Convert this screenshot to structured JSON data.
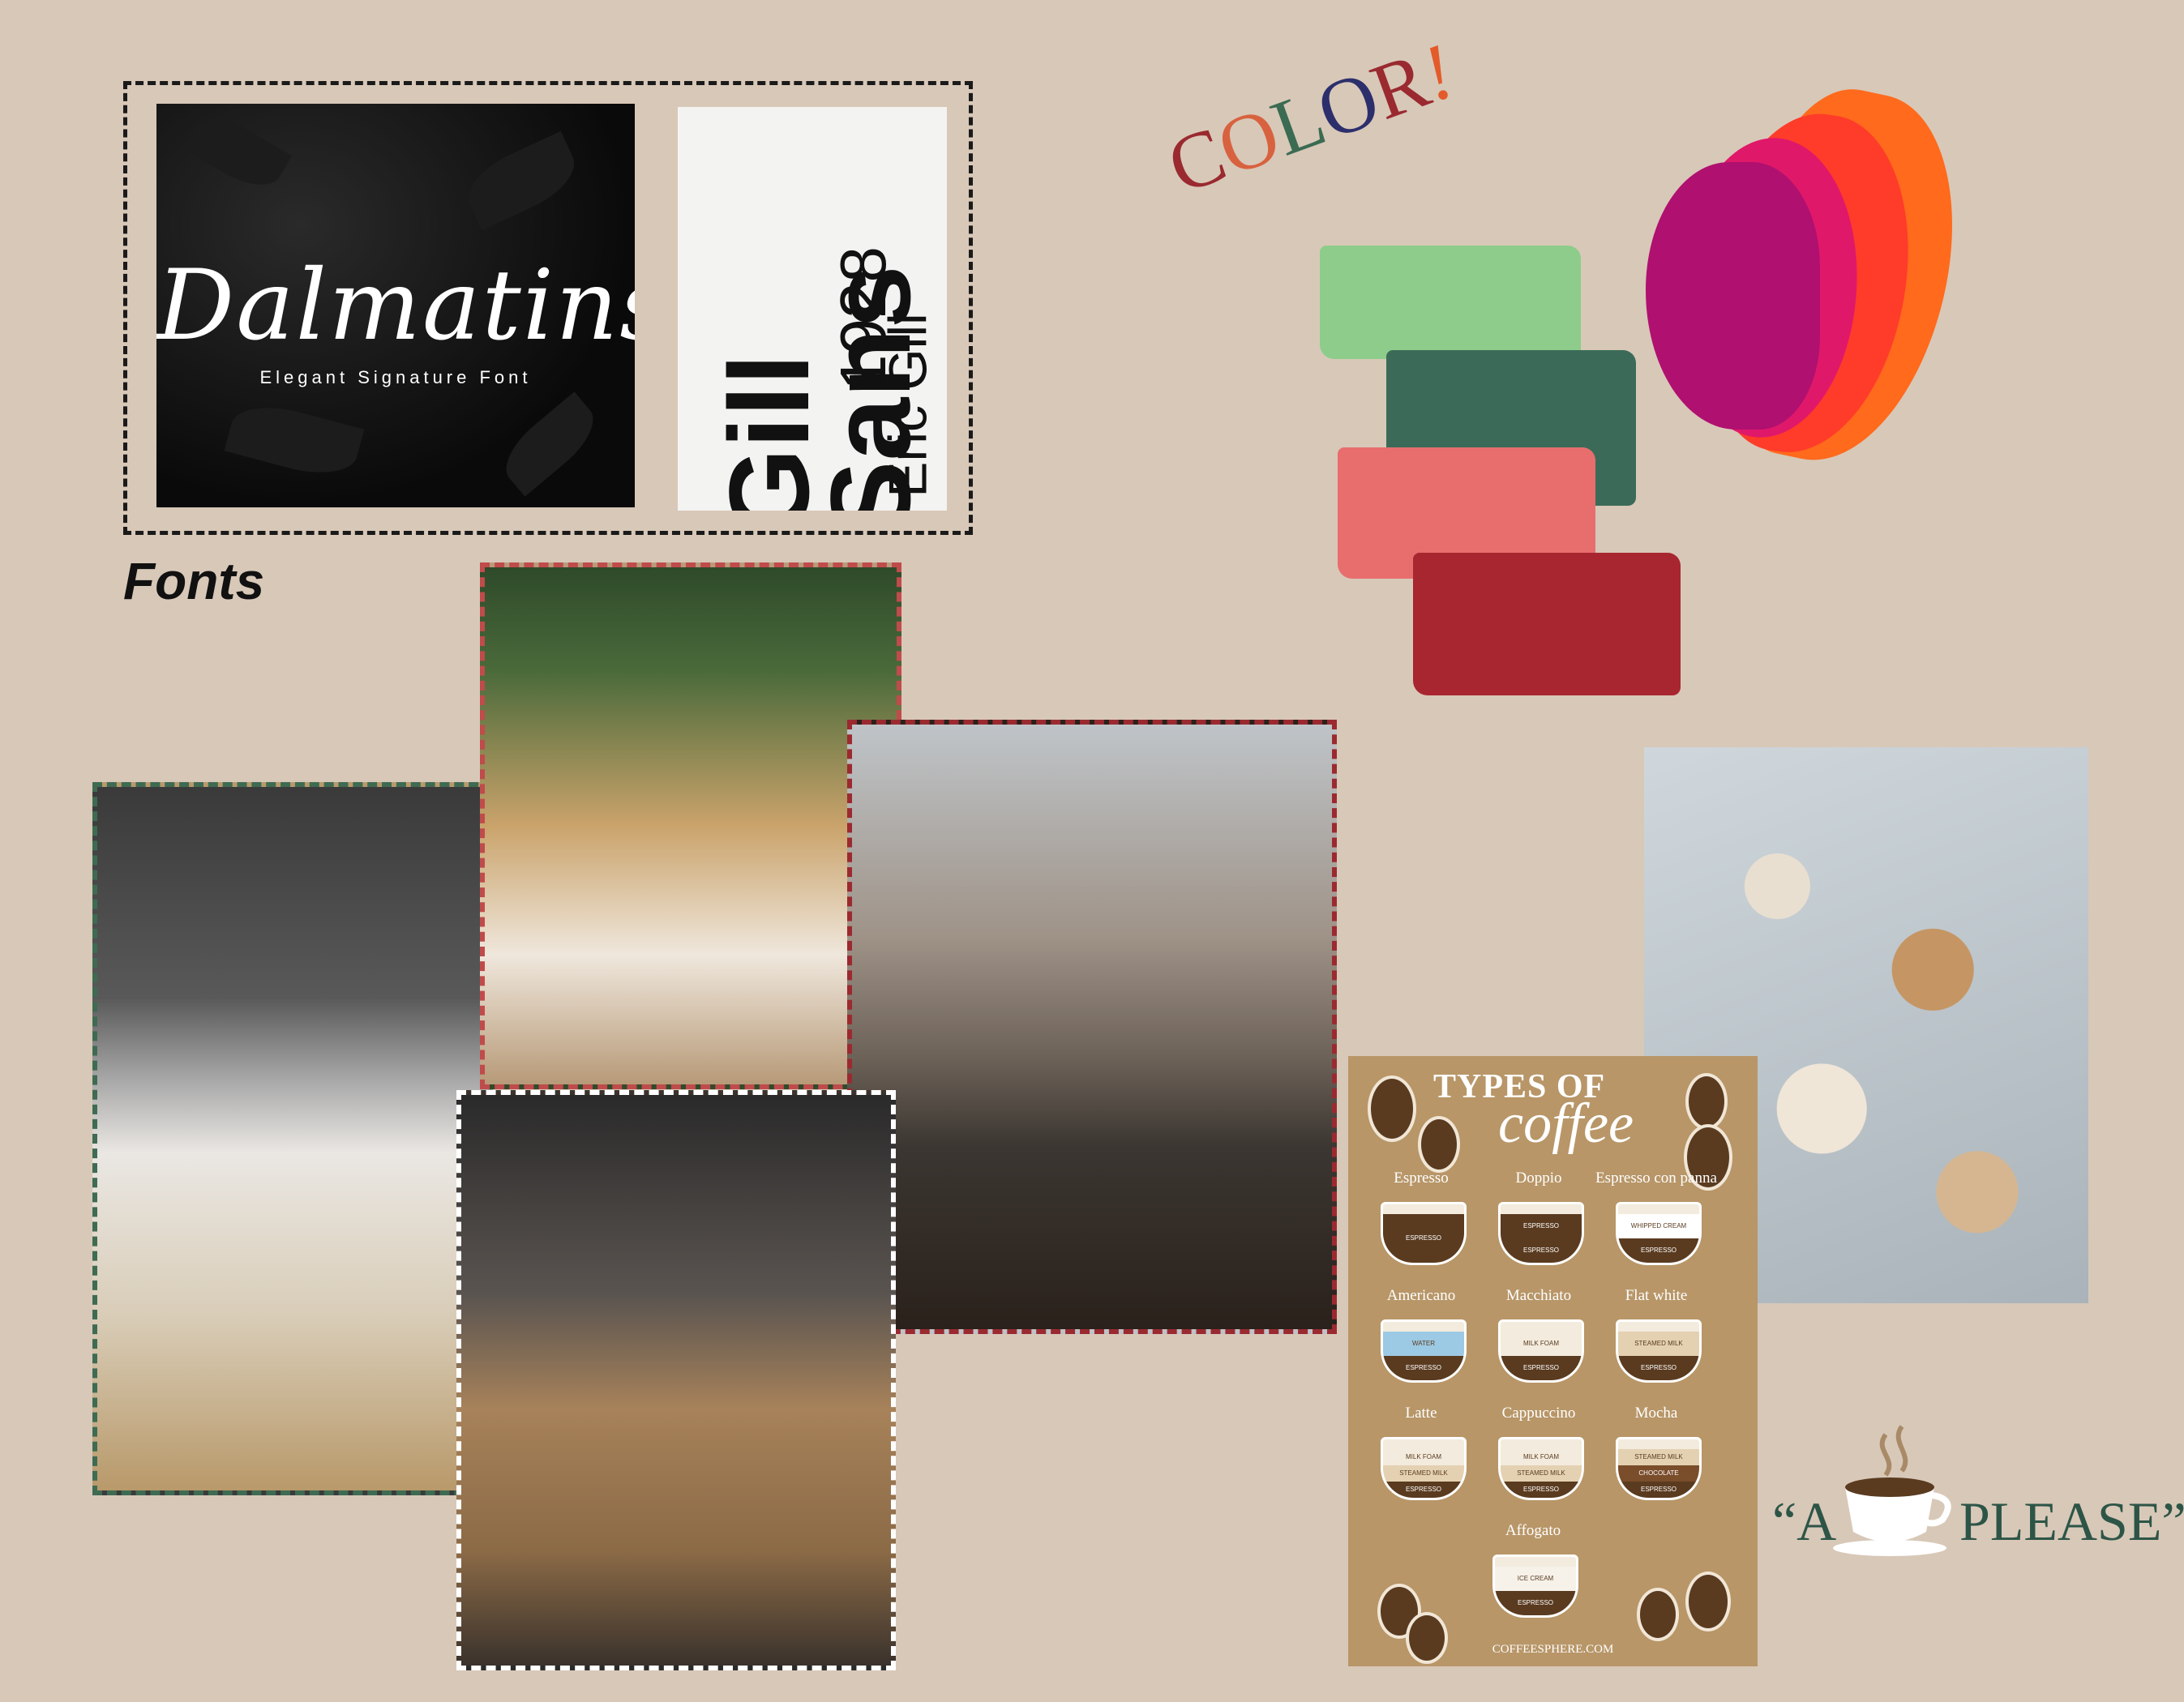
{
  "fonts": {
    "label": "Fonts",
    "dalmatins": {
      "title": "Dalmatins",
      "subtitle": "Elegant Signature Font"
    },
    "gill": {
      "line1": "Gill",
      "line2": "Sans",
      "year": "1928",
      "author": "Eric Gill"
    }
  },
  "color": {
    "letters": [
      {
        "ch": "C",
        "color": "#9a2a30"
      },
      {
        "ch": "O",
        "color": "#d8623f"
      },
      {
        "ch": "L",
        "color": "#3b6b52"
      },
      {
        "ch": "O",
        "color": "#2c2f6b"
      },
      {
        "ch": "R",
        "color": "#9a2a30"
      },
      {
        "ch": "!",
        "color": "#e35b2a"
      }
    ],
    "swatches": [
      "#8dcc8a",
      "#3b6b58",
      "#e86e6e",
      "#a8262f",
      "#ff6a1c",
      "#ff3b2a",
      "#e0186a",
      "#b01070"
    ]
  },
  "poster": {
    "title1": "TYPES OF",
    "title2": "coffee",
    "items": [
      {
        "name": "Espresso",
        "layers": [
          "ESPRESSO"
        ]
      },
      {
        "name": "Doppio",
        "layers": [
          "ESPRESSO",
          "ESPRESSO"
        ]
      },
      {
        "name": "Espresso con panna",
        "layers": [
          "WHIPPED CREAM",
          "ESPRESSO"
        ]
      },
      {
        "name": "Americano",
        "layers": [
          "WATER",
          "ESPRESSO"
        ]
      },
      {
        "name": "Macchiato",
        "layers": [
          "MILK FOAM",
          "ESPRESSO"
        ]
      },
      {
        "name": "Flat white",
        "layers": [
          "STEAMED MILK",
          "ESPRESSO"
        ]
      },
      {
        "name": "Latte",
        "layers": [
          "MILK FOAM",
          "STEAMED MILK",
          "ESPRESSO"
        ]
      },
      {
        "name": "Cappuccino",
        "layers": [
          "MILK FOAM",
          "STEAMED MILK",
          "ESPRESSO"
        ]
      },
      {
        "name": "Mocha",
        "layers": [
          "STEAMED MILK",
          "CHOCOLATE",
          "ESPRESSO"
        ]
      },
      {
        "name": "Affogato",
        "layers": [
          "ICE CREAM",
          "ESPRESSO"
        ]
      }
    ],
    "footer": "COFFEESPHERE.COM"
  },
  "tagline": {
    "left": "“A",
    "right": "PLEASE”",
    "icon": "coffee-cup-icon"
  }
}
